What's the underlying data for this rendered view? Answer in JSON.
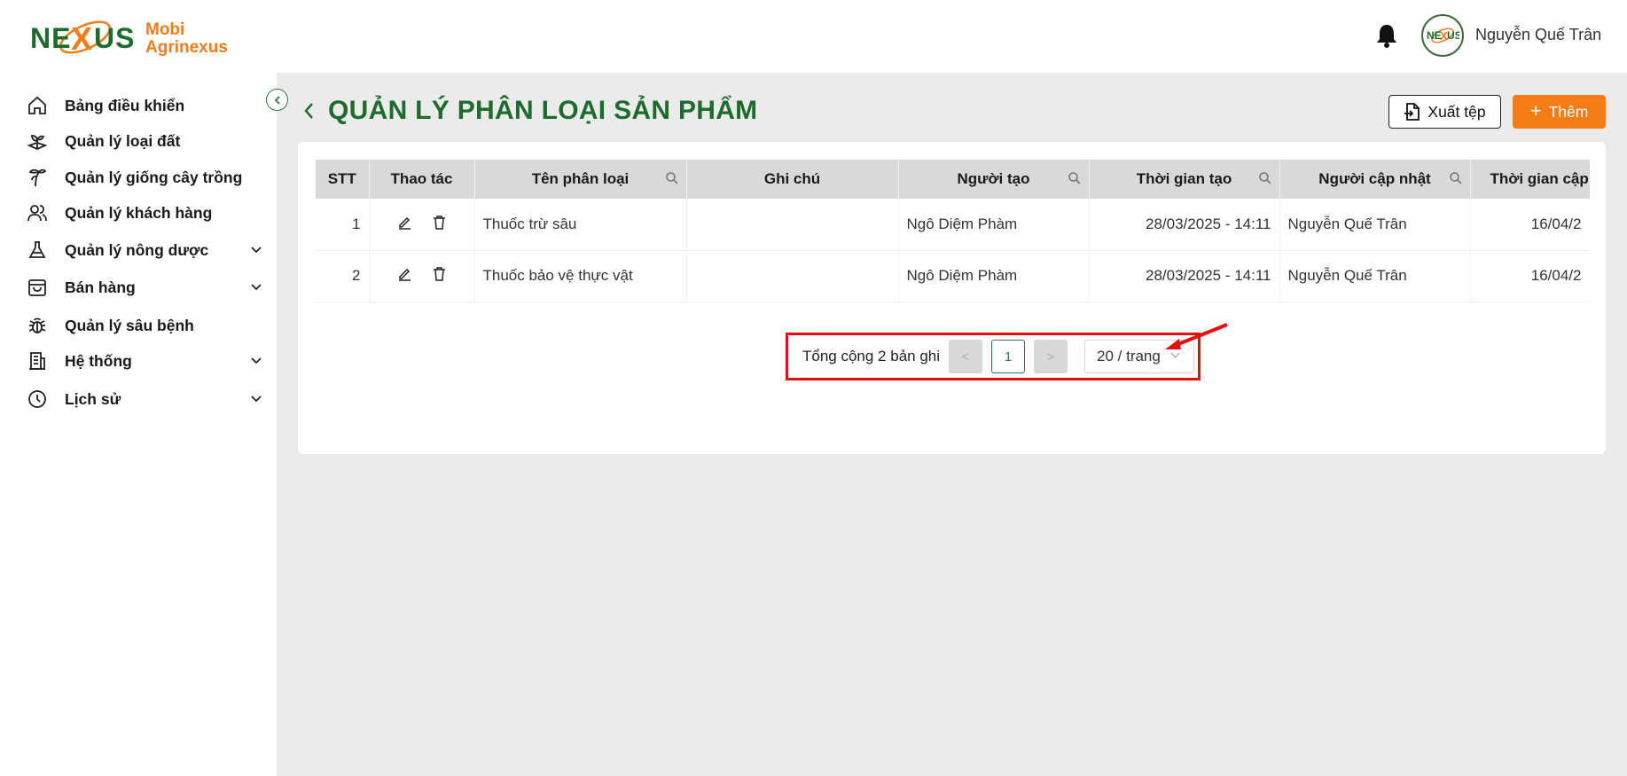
{
  "app": {
    "brand_line1": "Mobi",
    "brand_line2": "Agrinexus",
    "logo_text": "NEXUS",
    "user_name": "Nguyễn Quế Trân"
  },
  "sidebar": {
    "items": [
      {
        "label": "Bảng điều khiển",
        "icon": "home-icon",
        "has_children": false
      },
      {
        "label": "Quản lý loại đất",
        "icon": "soil-icon",
        "has_children": false
      },
      {
        "label": "Quản lý giống cây trồng",
        "icon": "plant-icon",
        "has_children": false
      },
      {
        "label": "Quản lý khách hàng",
        "icon": "users-icon",
        "has_children": false
      },
      {
        "label": "Quản lý nông dược",
        "icon": "flask-icon",
        "has_children": true
      },
      {
        "label": "Bán hàng",
        "icon": "bag-icon",
        "has_children": true
      },
      {
        "label": "Quản lý sâu bệnh",
        "icon": "bug-icon",
        "has_children": false
      },
      {
        "label": "Hệ thống",
        "icon": "building-icon",
        "has_children": true
      },
      {
        "label": "Lịch sử",
        "icon": "clock-icon",
        "has_children": true
      }
    ]
  },
  "page": {
    "title": "QUẢN LÝ PHÂN LOẠI SẢN PHẨM",
    "export_label": "Xuất tệp",
    "add_label": "Thêm"
  },
  "table": {
    "columns": [
      "STT",
      "Thao tác",
      "Tên phân loại",
      "Ghi chú",
      "Người tạo",
      "Thời gian tạo",
      "Người cập nhật",
      "Thời gian cập n"
    ],
    "rows": [
      {
        "stt": "1",
        "name": "Thuốc trừ sâu",
        "note": "",
        "creator": "Ngô Diệm Phàm",
        "created": "28/03/2025 - 14:11",
        "updater": "Nguyễn Quế Trân",
        "updated": "16/04/2"
      },
      {
        "stt": "2",
        "name": "Thuốc bảo vệ thực vật",
        "note": "",
        "creator": "Ngô Diệm Phàm",
        "created": "28/03/2025 - 14:11",
        "updater": "Nguyễn Quế Trân",
        "updated": "16/04/2"
      }
    ]
  },
  "pagination": {
    "total_text": "Tổng cộng 2 bản ghi",
    "prev": "<",
    "current_page": "1",
    "next": ">",
    "page_size": "20 / trang"
  },
  "colors": {
    "brand_green": "#1f6b2e",
    "accent_orange": "#f57c16",
    "highlight_red": "#e01010"
  }
}
